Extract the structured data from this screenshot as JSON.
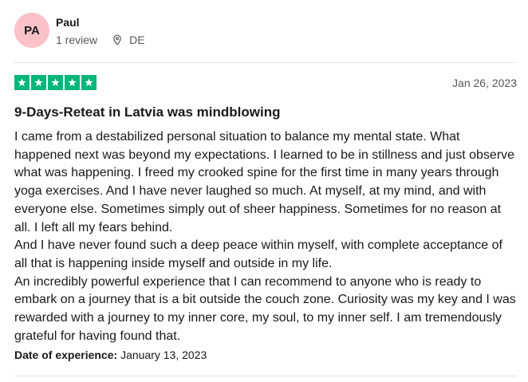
{
  "reviewer": {
    "initials": "PA",
    "name": "Paul",
    "review_count": "1 review",
    "country": "DE"
  },
  "rating": {
    "stars": 5,
    "max_stars": 5
  },
  "review": {
    "date": "Jan 26, 2023",
    "title": "9-Days-Reteat in Latvia was mindblowing",
    "paragraphs": [
      "I came from a destabilized personal situation to balance my mental state. What happened next was beyond my expectations. I learned to be in stillness and just observe what was happening. I freed my crooked spine for the first time in many years through yoga exercises. And I have never laughed so much. At myself, at my mind, and with everyone else. Sometimes simply out of sheer happiness. Sometimes for no reason at all. I left all my fears behind.",
      "And I have never found such a deep peace within myself, with complete acceptance of all that is happening inside myself and outside in my life.",
      "An incredibly powerful experience that I can recommend to anyone who is ready to embark on a journey that is a bit outside the couch zone. Curiosity was my key and I was rewarded with a journey to my inner core, my soul, to my inner self. I am tremendously grateful for having found that."
    ],
    "experience_label": "Date of experience:",
    "experience_date": "January 13, 2023"
  },
  "colors": {
    "star_green": "#00b67a",
    "avatar_pink": "#fbc1c9",
    "muted_text": "#575757",
    "divider": "#e5e5dd"
  }
}
